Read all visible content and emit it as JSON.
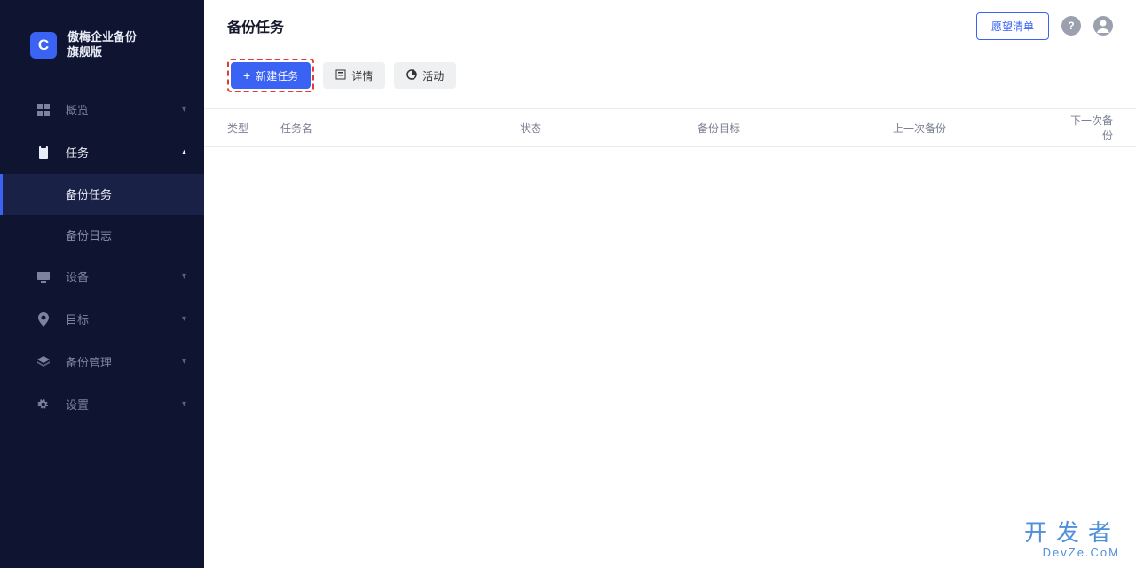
{
  "brand": {
    "logo_letter": "C",
    "title_line1": "傲梅企业备份",
    "title_line2": "旗舰版"
  },
  "sidebar": {
    "items": [
      {
        "label": "概览"
      },
      {
        "label": "任务"
      },
      {
        "label": "设备"
      },
      {
        "label": "目标"
      },
      {
        "label": "备份管理"
      },
      {
        "label": "设置"
      }
    ],
    "sub_tasks": [
      {
        "label": "备份任务"
      },
      {
        "label": "备份日志"
      }
    ]
  },
  "header": {
    "title": "备份任务",
    "wish_button": "愿望清单"
  },
  "toolbar": {
    "new_label": "新建任务",
    "details_label": "详情",
    "activity_label": "活动"
  },
  "table": {
    "columns": {
      "type": "类型",
      "name": "任务名",
      "status": "状态",
      "target": "备份目标",
      "last": "上一次备份",
      "next": "下一次备份"
    },
    "rows": []
  },
  "watermark": {
    "line1": "开发者",
    "line2": "DevZe.CoM"
  }
}
